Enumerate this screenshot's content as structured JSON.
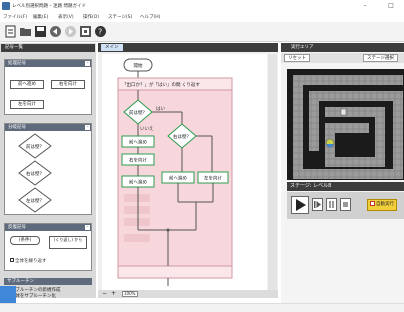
{
  "window": {
    "title": "レベル別選択問題 – 迷路 問題ガイド",
    "minimize": "–",
    "maximize": "□"
  },
  "menu": [
    "ファイル(F)",
    "編集(E)",
    "表示(V)",
    "操作(O)",
    "ステージ(S)",
    "ヘルプ(H)"
  ],
  "toolbar": {
    "icons": [
      "new-file-icon",
      "open-folder-icon",
      "save-icon",
      "back-icon",
      "forward-icon",
      "record-icon",
      "help-icon"
    ]
  },
  "left_panel": {
    "tab": "記号一覧",
    "groups": [
      {
        "title": "処理記号",
        "items": [
          "前へ進め",
          "右を向け",
          "左を向け"
        ]
      },
      {
        "title": "分岐記号",
        "items": [
          "前は壁？",
          "右は壁？",
          "左は壁？"
        ]
      },
      {
        "title": "反復記号",
        "items": [
          "(条件)",
          "(くり返し) から"
        ],
        "option": "全体を繰り返す"
      }
    ],
    "sub": {
      "title": "サブルーチン",
      "items": [
        "サブルーチンの新規作成",
        "全体をサブルーチン化"
      ]
    }
  },
  "center": {
    "tab": "メイン",
    "zoom": "100%",
    "flowchart": {
      "start": "開始",
      "loop": "「出口か？」が「はい」の間 くり返す",
      "cond1": "前は壁？",
      "cond2": "右は壁？",
      "yes": "いいえ",
      "no": "はい",
      "step1": "前へ進め",
      "step2": "右を向け",
      "step3": "前へ進め",
      "step4": "前へ進め",
      "step5": "左を向け"
    }
  },
  "right_panel": {
    "tab": "実行エリア",
    "reset": "リセット",
    "stage_select": "ステージ選択",
    "stage": "ステージ: レベル8",
    "checkbox": "自動実行"
  },
  "colors": {
    "accent": "#3f88d9",
    "panel_dark": "#3d3d3d",
    "loop_fill": "#f7d7dc",
    "maze_floor": "#9b9b9b",
    "maze_wall": "#1b1b1b"
  }
}
